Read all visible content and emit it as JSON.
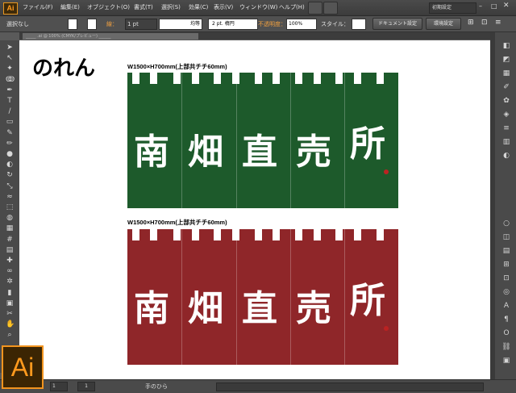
{
  "app": {
    "logo": "Ai"
  },
  "menu": {
    "items": [
      "ファイル(F)",
      "編集(E)",
      "オブジェクト(O)",
      "書式(T)",
      "選択(S)",
      "効果(C)",
      "表示(V)",
      "ウィンドウ(W)",
      "ヘルプ(H)"
    ],
    "workspace": "初期設定"
  },
  "control": {
    "selection": "選択なし",
    "stroke_label": "線：",
    "stroke_weight": "1 pt",
    "stroke_profile": "均等",
    "brush": "2 pt. 楕円",
    "opacity_label": "不透明度：",
    "opacity_value": "100%",
    "style_label": "スタイル：",
    "doc_settings": "ドキュメント設定",
    "preferences": "環境設定"
  },
  "document_tab": "_____ .ai @ 100% (CMYK/プレビュー) ______",
  "canvas": {
    "title": "のれん",
    "curtains": [
      {
        "label": "W1500×H700mm(上部共チチ60mm)",
        "color": "#1d5a2b",
        "text": [
          "南",
          "畑",
          "直",
          "売",
          "所"
        ]
      },
      {
        "label": "W1500×H700mm(上部共チチ60mm)",
        "color": "#8f2629",
        "text": [
          "南",
          "畑",
          "直",
          "売",
          "所"
        ]
      }
    ]
  },
  "status": {
    "zoom": "1",
    "page": "1",
    "tool": "手のひら"
  },
  "icons": {
    "tools": [
      "selection-arrow-icon",
      "direct-selection-icon",
      "magic-wand-icon",
      "lasso-icon",
      "pen-icon",
      "type-icon",
      "line-icon",
      "rectangle-icon",
      "paintbrush-icon",
      "pencil-icon",
      "blob-brush-icon",
      "eraser-icon",
      "rotate-icon",
      "scale-icon",
      "warp-icon",
      "free-transform-icon",
      "shape-builder-icon",
      "perspective-icon",
      "mesh-icon",
      "gradient-icon",
      "eyedropper-icon",
      "blend-icon",
      "symbol-sprayer-icon",
      "column-graph-icon",
      "artboard-icon",
      "slice-icon",
      "hand-icon",
      "zoom-icon"
    ],
    "dock": [
      "color-icon",
      "color-guide-icon",
      "swatches-icon",
      "brushes-icon",
      "symbols-icon",
      "graphic-styles-icon",
      "stroke-icon",
      "gradient-panel-icon",
      "transparency-icon",
      "appearance-icon",
      "layers-icon",
      "artboards-icon",
      "align-icon",
      "transform-icon",
      "pathfinder-icon",
      "character-icon",
      "paragraph-icon",
      "opentype-icon",
      "links-icon",
      "navigator-icon"
    ]
  }
}
